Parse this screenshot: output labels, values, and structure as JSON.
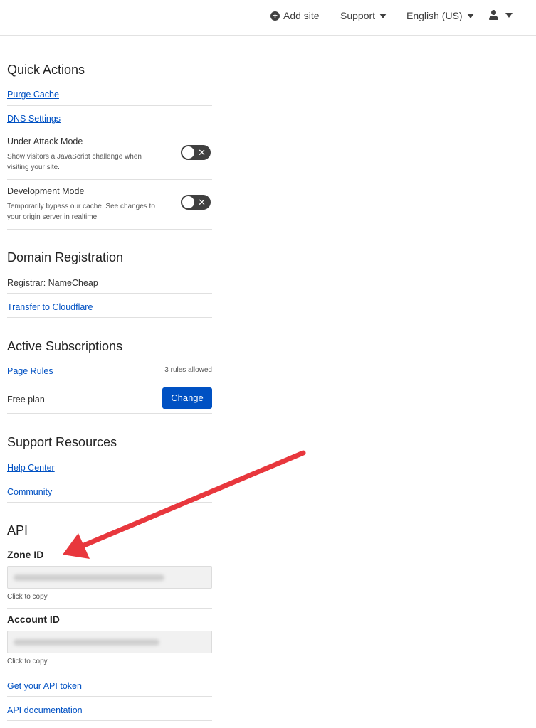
{
  "topbar": {
    "add_site": "Add site",
    "support": "Support",
    "language": "English (US)"
  },
  "quick_actions": {
    "title": "Quick Actions",
    "purge_cache": "Purge Cache",
    "dns_settings": "DNS Settings",
    "under_attack": {
      "title": "Under Attack Mode",
      "description": "Show visitors a JavaScript challenge when visiting your site.",
      "enabled": false
    },
    "development": {
      "title": "Development Mode",
      "description": "Temporarily bypass our cache. See changes to your origin server in realtime.",
      "enabled": false
    }
  },
  "domain_registration": {
    "title": "Domain Registration",
    "registrar": "Registrar: NameCheap",
    "transfer": "Transfer to Cloudflare"
  },
  "subscriptions": {
    "title": "Active Subscriptions",
    "page_rules": "Page Rules",
    "rules_allowed": "3 rules allowed",
    "plan": "Free plan",
    "change": "Change"
  },
  "support_resources": {
    "title": "Support Resources",
    "help_center": "Help Center",
    "community": "Community"
  },
  "api": {
    "title": "API",
    "zone_id_label": "Zone ID",
    "zone_copy_hint": "Click to copy",
    "account_id_label": "Account ID",
    "account_copy_hint": "Click to copy",
    "api_token": "Get your API token",
    "api_docs": "API documentation"
  },
  "colors": {
    "link": "#0051c3",
    "button": "#0051c3",
    "arrow": "#e8373d",
    "toggle_off": "#404040"
  },
  "icons": {
    "add_site": "plus-circle-icon",
    "dropdown": "caret-down-icon",
    "user": "user-icon",
    "toggle_off": "close-icon"
  }
}
